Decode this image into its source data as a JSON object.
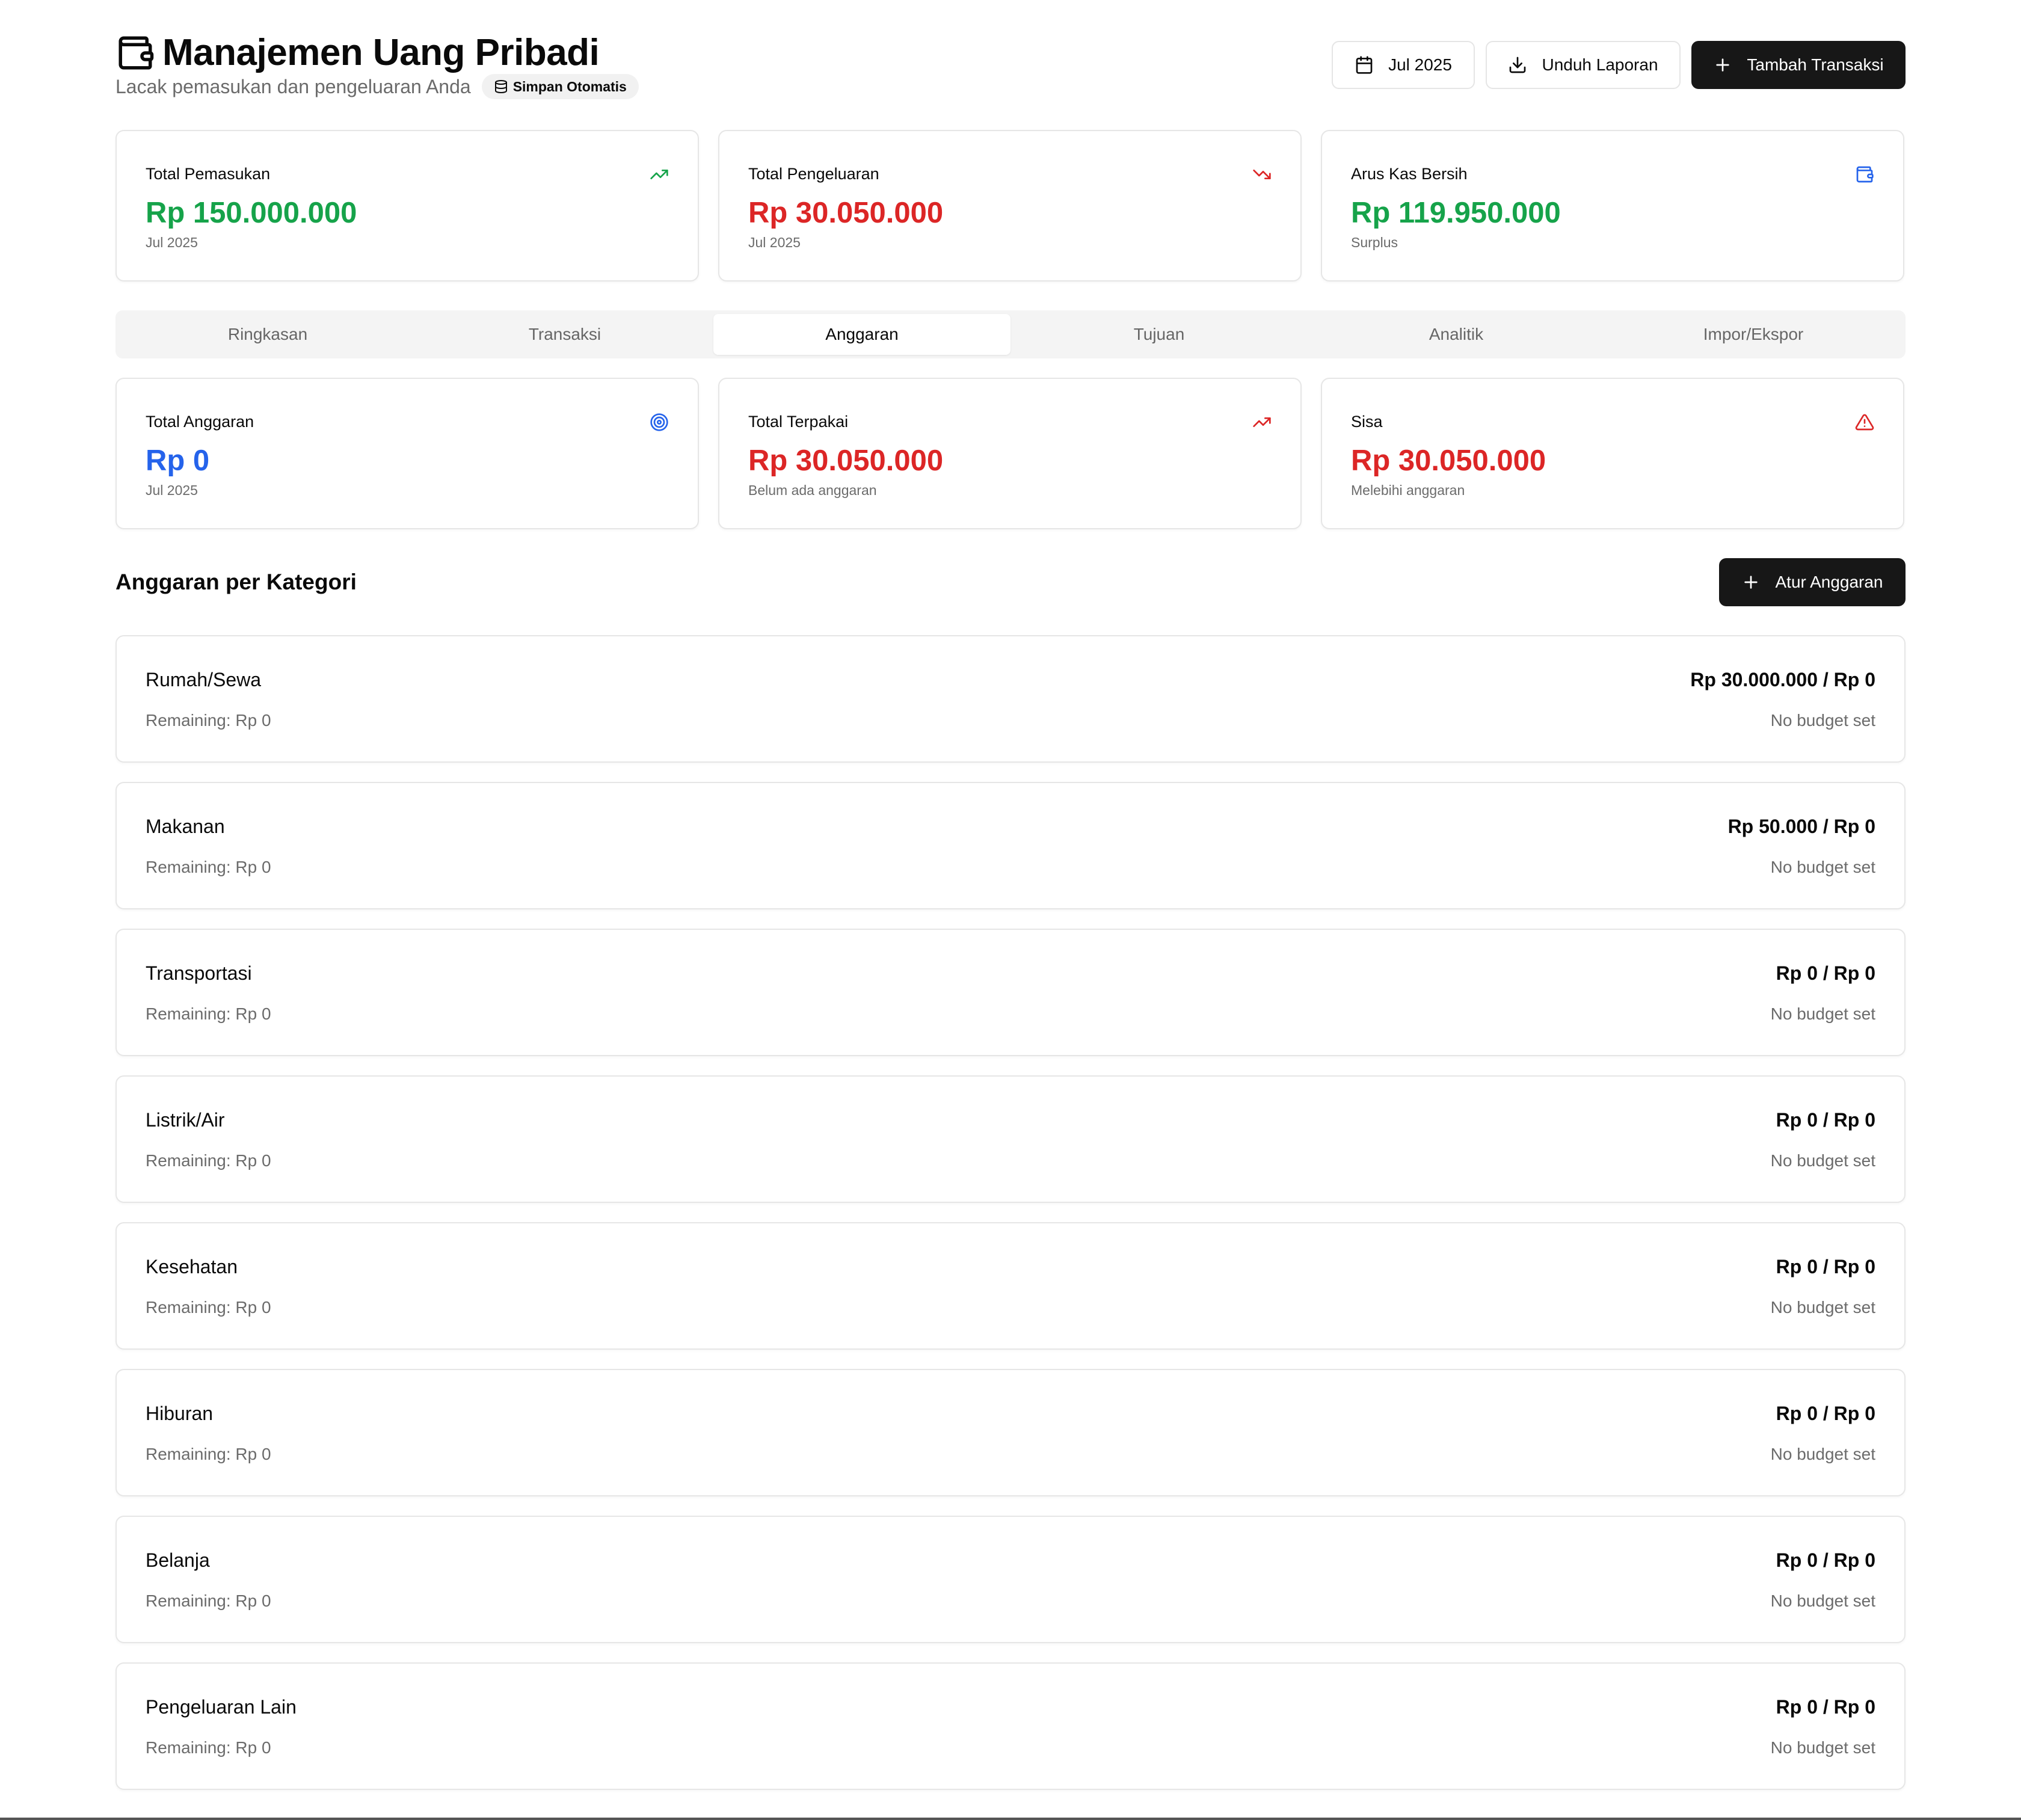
{
  "header": {
    "title": "Manajemen Uang Pribadi",
    "title_icon": "wallet-icon",
    "subtitle": "Lacak pemasukan dan pengeluaran Anda",
    "autosave_label": "Simpan Otomatis",
    "date_button": "Jul 2025",
    "download_button": "Unduh Laporan",
    "add_transaction_button": "Tambah Transaksi"
  },
  "summary_cards": [
    {
      "label": "Total Pemasukan",
      "value": "Rp 150.000.000",
      "sub": "Jul 2025",
      "icon": "trending-up-icon",
      "color": "#16a34a"
    },
    {
      "label": "Total Pengeluaran",
      "value": "Rp 30.050.000",
      "sub": "Jul 2025",
      "icon": "trending-down-icon",
      "color": "#dc2626"
    },
    {
      "label": "Arus Kas Bersih",
      "value": "Rp 119.950.000",
      "sub": "Surplus",
      "icon": "wallet-icon",
      "color": "#16a34a"
    }
  ],
  "tabs": [
    {
      "label": "Ringkasan",
      "active": false
    },
    {
      "label": "Transaksi",
      "active": false
    },
    {
      "label": "Anggaran",
      "active": true
    },
    {
      "label": "Tujuan",
      "active": false
    },
    {
      "label": "Analitik",
      "active": false
    },
    {
      "label": "Impor/Ekspor",
      "active": false
    }
  ],
  "budget_cards": [
    {
      "label": "Total Anggaran",
      "value": "Rp 0",
      "sub": "Jul 2025",
      "icon": "target-icon",
      "color": "#2563eb"
    },
    {
      "label": "Total Terpakai",
      "value": "Rp 30.050.000",
      "sub": "Belum ada anggaran",
      "icon": "trending-up-icon",
      "color": "#dc2626"
    },
    {
      "label": "Sisa",
      "value": "Rp 30.050.000",
      "sub": "Melebihi anggaran",
      "icon": "alert-triangle-icon",
      "color": "#dc2626"
    }
  ],
  "section": {
    "title": "Anggaran per Kategori",
    "set_budget_button": "Atur Anggaran"
  },
  "categories": [
    {
      "name": "Rumah/Sewa",
      "remaining": "Remaining: Rp 0",
      "amount": "Rp 30.000.000 / Rp 0",
      "status": "No budget set"
    },
    {
      "name": "Makanan",
      "remaining": "Remaining: Rp 0",
      "amount": "Rp 50.000 / Rp 0",
      "status": "No budget set"
    },
    {
      "name": "Transportasi",
      "remaining": "Remaining: Rp 0",
      "amount": "Rp 0 / Rp 0",
      "status": "No budget set"
    },
    {
      "name": "Listrik/Air",
      "remaining": "Remaining: Rp 0",
      "amount": "Rp 0 / Rp 0",
      "status": "No budget set"
    },
    {
      "name": "Kesehatan",
      "remaining": "Remaining: Rp 0",
      "amount": "Rp 0 / Rp 0",
      "status": "No budget set"
    },
    {
      "name": "Hiburan",
      "remaining": "Remaining: Rp 0",
      "amount": "Rp 0 / Rp 0",
      "status": "No budget set"
    },
    {
      "name": "Belanja",
      "remaining": "Remaining: Rp 0",
      "amount": "Rp 0 / Rp 0",
      "status": "No budget set"
    },
    {
      "name": "Pengeluaran Lain",
      "remaining": "Remaining: Rp 0",
      "amount": "Rp 0 / Rp 0",
      "status": "No budget set"
    }
  ]
}
